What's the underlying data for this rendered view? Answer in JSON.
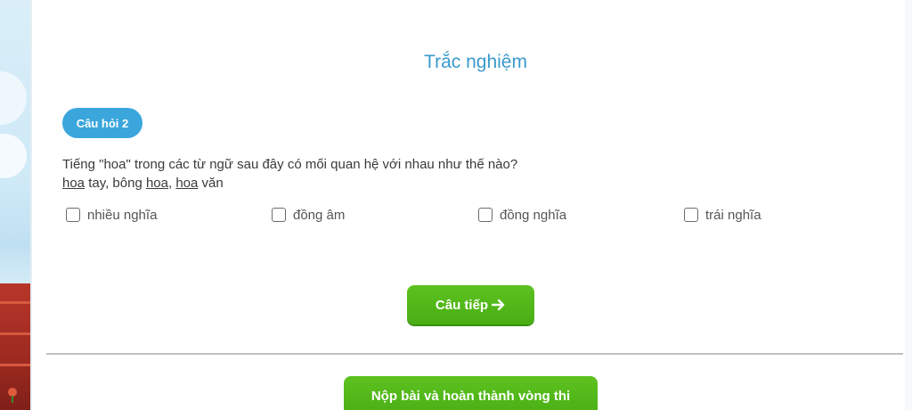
{
  "quiz": {
    "title": "Trắc nghiệm",
    "question_badge": "Câu hỏi 2",
    "question_line1": "Tiếng \"hoa\" trong các từ ngữ sau đây có mối quan hệ với nhau như thế nào?",
    "question_line2": {
      "w1": "hoa",
      "t1": " tay, bông ",
      "w2": "hoa",
      "t2": ", ",
      "w3": "hoa",
      "t3": " văn"
    },
    "options": [
      {
        "label": "nhiều nghĩa",
        "checked": false
      },
      {
        "label": "đồng âm",
        "checked": false
      },
      {
        "label": "đồng nghĩa",
        "checked": false
      },
      {
        "label": "trái nghĩa",
        "checked": false
      }
    ]
  },
  "buttons": {
    "next_label": "Câu tiếp",
    "next_icon": "arrow-right-icon",
    "submit_label": "Nộp bài và hoàn thành vòng thi"
  },
  "colors": {
    "title": "#3a9acb",
    "badge": "#3aa6dc",
    "button_green": "#52b81a"
  }
}
